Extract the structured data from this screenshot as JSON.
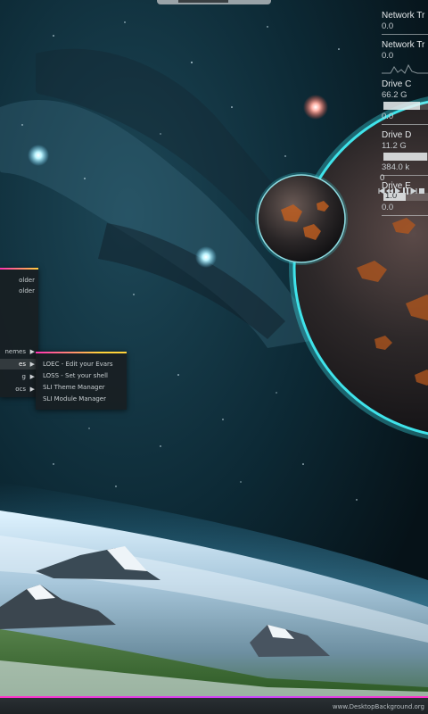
{
  "monitor": {
    "net_in": {
      "label": "Network Tr",
      "value": "0.0"
    },
    "net_out": {
      "label": "Network Tr",
      "value": "0.0"
    },
    "drive_c": {
      "label": "Drive C",
      "used": "66.2 G",
      "free": "0.0",
      "fill": 0.82
    },
    "drive_d": {
      "label": "Drive D",
      "used": "11.2 G",
      "free": "384.0 k",
      "fill": 0.98
    },
    "drive_e": {
      "label": "Drive E",
      "used": "1.0",
      "free": "0.0",
      "fill": 0.5
    }
  },
  "media": {
    "time": "0",
    "buttons": [
      "prev-icon",
      "rewind-icon",
      "play-icon",
      "pause-icon",
      "next-icon",
      "stop-icon"
    ]
  },
  "start_menu": {
    "items": [
      {
        "label": "older",
        "arrow": false
      },
      {
        "label": "older",
        "arrow": false
      },
      {
        "label": "nemes",
        "arrow": true
      },
      {
        "label": "es",
        "arrow": true,
        "selected": true
      },
      {
        "label": "g",
        "arrow": true
      },
      {
        "label": "ocs",
        "arrow": true
      }
    ],
    "arrow_glyph": "▶"
  },
  "sub_menu": {
    "items": [
      {
        "label": "LOEC - Edit your Evars"
      },
      {
        "label": "LOSS - Set your shell"
      },
      {
        "label": "SLI Theme Manager"
      },
      {
        "label": "SLI Module Manager"
      }
    ]
  },
  "watermark": "www.DesktopBackground.org",
  "colors": {
    "accent_pink": "#ff2fb5",
    "accent_yellow": "#ffd23a",
    "planet_glow": "#3fe3ea"
  }
}
